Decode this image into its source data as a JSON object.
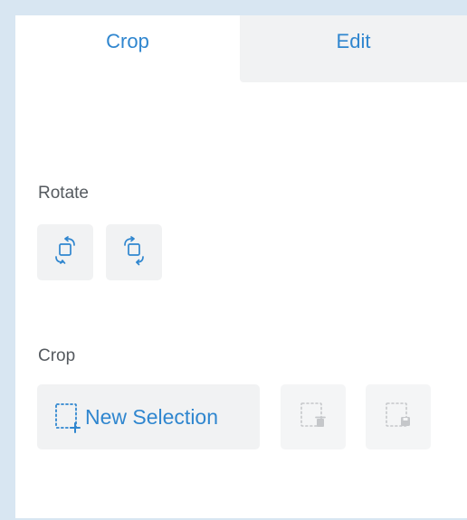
{
  "tabs": [
    {
      "label": "Crop",
      "active": true
    },
    {
      "label": "Edit",
      "active": false
    }
  ],
  "rotate": {
    "label": "Rotate",
    "buttons": [
      {
        "icon": "rotate-left-icon"
      },
      {
        "icon": "rotate-right-icon"
      }
    ]
  },
  "crop": {
    "label": "Crop",
    "new_selection_label": "New Selection",
    "new_selection_icon": "selection-add-icon",
    "delete_selection_icon": "selection-delete-icon",
    "save_selection_icon": "selection-save-icon"
  },
  "colors": {
    "accent": "#2f86cf",
    "button_bg": "#f1f2f3",
    "icon_disabled": "#c5c7ca",
    "border": "#d8e6f2"
  }
}
